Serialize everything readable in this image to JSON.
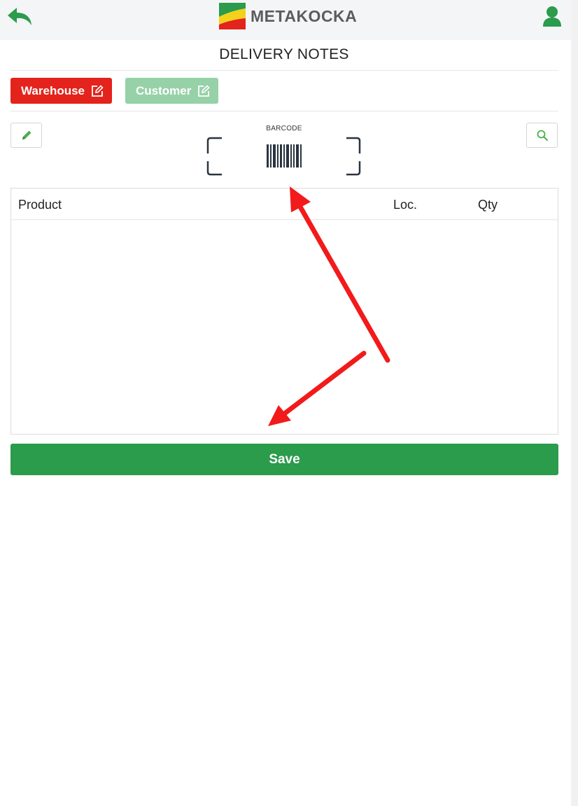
{
  "header": {
    "logo_text": "METAKOCKA",
    "back_icon": "back-arrow-icon",
    "user_icon": "user-icon"
  },
  "page": {
    "title": "DELIVERY NOTES"
  },
  "filters": {
    "warehouse_label": "Warehouse",
    "customer_label": "Customer"
  },
  "scanner": {
    "label": "BARCODE"
  },
  "table": {
    "columns": [
      "Product",
      "Loc.",
      "Qty"
    ],
    "rows": []
  },
  "actions": {
    "save_label": "Save"
  },
  "colors": {
    "warehouse_button": "#e3231c",
    "customer_button": "#97d1a8",
    "save_button": "#2b9b4c",
    "annotation_arrow": "#f21a1a"
  }
}
